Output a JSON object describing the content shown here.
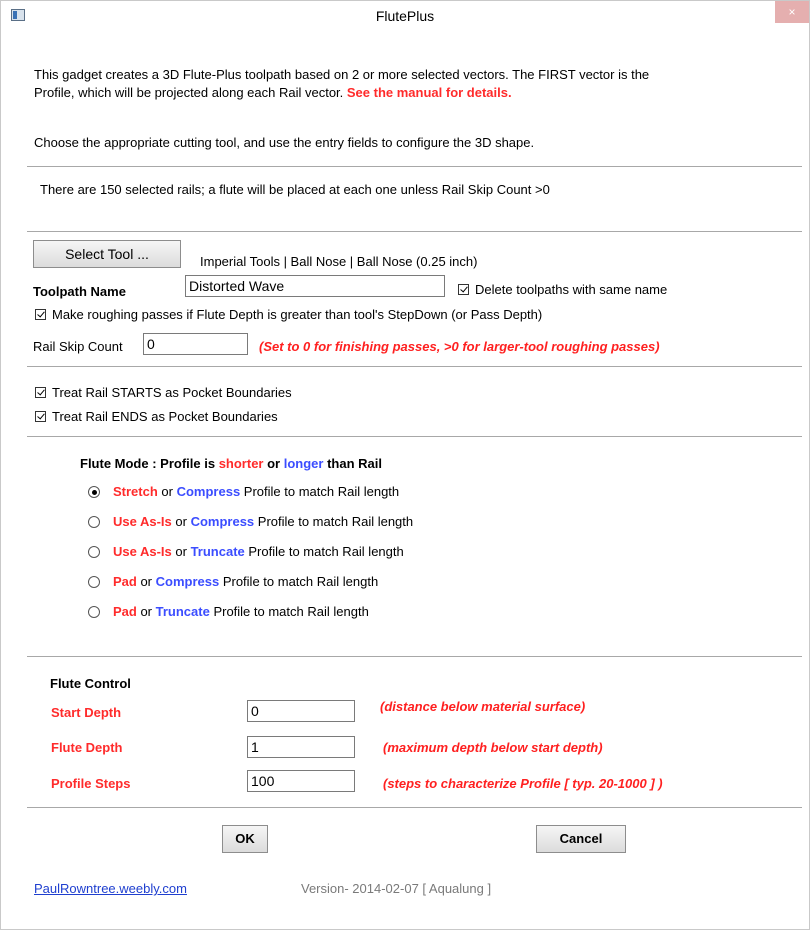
{
  "window": {
    "title": "FlutePlus",
    "close_label": "×"
  },
  "intro": {
    "line1": "This gadget creates a 3D Flute-Plus toolpath based on 2 or more selected vectors.  The FIRST vector is the",
    "line2_prefix": "Profile, which will be projected along each Rail vector. ",
    "line2_manual": "See the manual for details.",
    "line3": "Choose the appropriate cutting tool, and use the entry fields to configure the 3D shape."
  },
  "rails_info": "There are 150 selected rails; a flute will be placed at each one unless Rail Skip Count >0",
  "tool": {
    "select_label": "Select Tool ...",
    "description": "Imperial Tools | Ball Nose | Ball Nose (0.25 inch)"
  },
  "toolpath": {
    "name_label": "Toolpath Name",
    "name_value": "Distorted Wave",
    "delete_label": "Delete toolpaths with same name",
    "delete_checked": true
  },
  "roughing": {
    "label": "Make roughing passes if Flute Depth is greater than tool's StepDown (or Pass Depth)",
    "checked": true
  },
  "rail_skip": {
    "label": "Rail Skip Count",
    "value": "0",
    "hint": "(Set to 0 for finishing passes, >0 for larger-tool roughing passes)"
  },
  "pockets": {
    "starts_label": "Treat Rail STARTS as Pocket Boundaries",
    "starts_checked": true,
    "ends_label": "Treat Rail ENDS as Pocket Boundaries",
    "ends_checked": true
  },
  "flute_mode": {
    "heading_prefix": "Flute Mode : Profile is ",
    "heading_shorter": "shorter",
    "heading_or": " or ",
    "heading_longer": "longer",
    "heading_suffix": " than Rail",
    "options": [
      {
        "a": "Stretch",
        "or": " or ",
        "b": "Compress",
        "rest": " Profile to match Rail length",
        "selected": true
      },
      {
        "a": "Use As-Is",
        "or": " or ",
        "b": "Compress",
        "rest": " Profile to match Rail length",
        "selected": false
      },
      {
        "a": "Use As-Is",
        "or": " or ",
        "b": "Truncate",
        "rest": " Profile to match Rail length",
        "selected": false
      },
      {
        "a": "Pad",
        "or": " or ",
        "b": "Compress",
        "rest": " Profile to match Rail length",
        "selected": false
      },
      {
        "a": "Pad",
        "or": " or ",
        "b": "Truncate",
        "rest": " Profile to match Rail length",
        "selected": false
      }
    ]
  },
  "flute_control": {
    "heading": "Flute Control",
    "start_depth": {
      "label": "Start Depth",
      "value": "0",
      "hint": "(distance below material surface)"
    },
    "flute_depth": {
      "label": "Flute Depth",
      "value": "1",
      "hint": "(maximum depth below start depth)"
    },
    "profile_steps": {
      "label": "Profile Steps",
      "value": "100",
      "hint": "(steps to characterize Profile [ typ. 20-1000 ] )"
    }
  },
  "buttons": {
    "ok": "OK",
    "cancel": "Cancel"
  },
  "footer": {
    "link": "PaulRowntree.weebly.com",
    "version": "Version- 2014-02-07 [ Aqualung ]"
  }
}
